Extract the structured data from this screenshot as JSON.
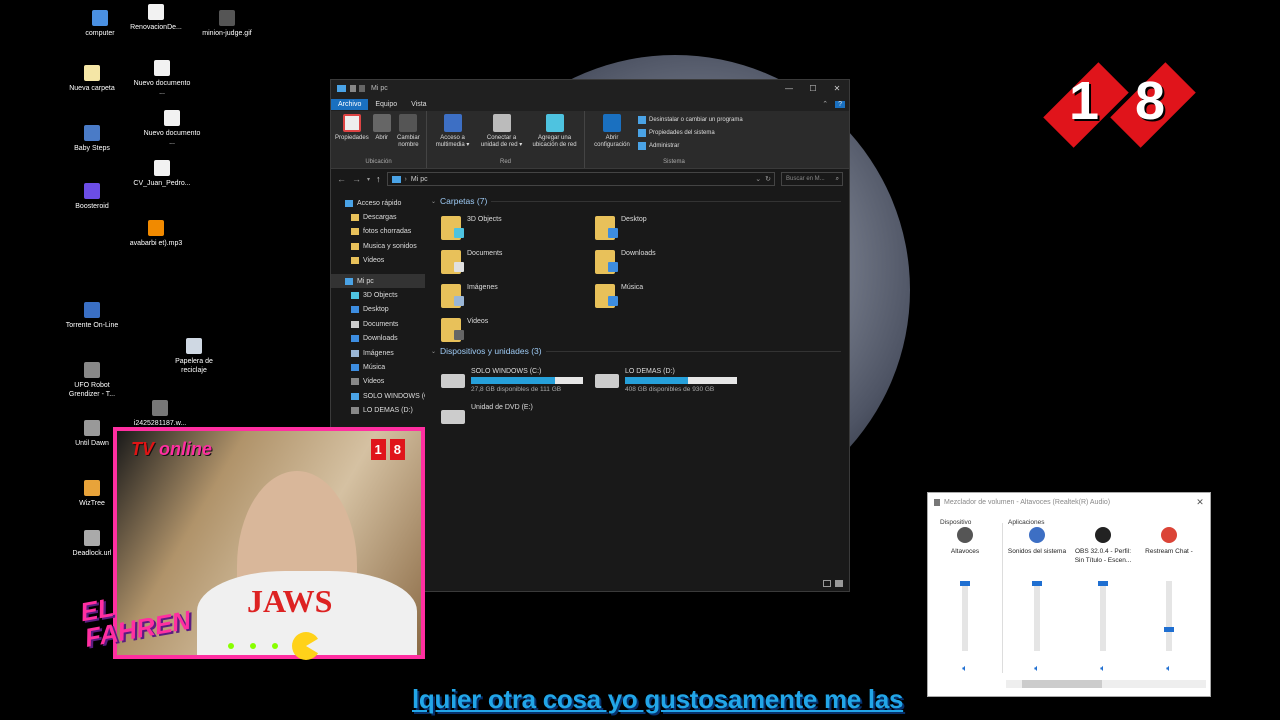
{
  "desktop_icons": [
    {
      "label": "computer",
      "icon": "monitor-icon",
      "color": "#4a90e2"
    },
    {
      "label": "RenovacionDe...",
      "icon": "pdf-icon",
      "color": "#f2f2f2"
    },
    {
      "label": "minion-judge.gif",
      "icon": "gif-icon",
      "color": "#555555"
    },
    {
      "label": "Nueva carpeta",
      "icon": "file-icon",
      "color": "#f5e6a6"
    },
    {
      "label": "Nuevo documento ...",
      "icon": "document-icon",
      "color": "#f2f2f2"
    },
    {
      "label": "Baby Steps",
      "icon": "game-icon",
      "color": "#4a7bc7"
    },
    {
      "label": "Nuevo documento ...",
      "icon": "document-icon",
      "color": "#f2f2f2"
    },
    {
      "label": "Boosteroid",
      "icon": "boosteroid-icon",
      "color": "#6b4de6"
    },
    {
      "label": "CV_Juan_Pedro...",
      "icon": "document-icon",
      "color": "#f2f2f2"
    },
    {
      "label": "avabarbi et).mp3",
      "icon": "vlc-icon",
      "color": "#f18a00"
    },
    {
      "label": "Torrente On-Line",
      "icon": "torrent-icon",
      "color": "#3a6fc4"
    },
    {
      "label": "Papelera de reciclaje",
      "icon": "recycle-bin-icon",
      "color": "#cfd8e3"
    },
    {
      "label": "UFO Robot Grendizer - T...",
      "icon": "game-icon",
      "color": "#888888"
    },
    {
      "label": "Until Dawn",
      "icon": "game-icon",
      "color": "#999999"
    },
    {
      "label": "i2425281187.w...",
      "icon": "image-icon",
      "color": "#777777"
    },
    {
      "label": "WizTree",
      "icon": "wiztree-icon",
      "color": "#e8a33a"
    },
    {
      "label": "Deadlock.url",
      "icon": "link-icon",
      "color": "#aaaaaa"
    }
  ],
  "badge": {
    "digits": [
      "1",
      "8"
    ],
    "color": "#e0141b"
  },
  "explorer": {
    "title": "Mi pc",
    "window_controls": [
      "—",
      "☐",
      "✕"
    ],
    "tabs": [
      "Archivo",
      "Equipo",
      "Vista"
    ],
    "ribbon": {
      "groups": [
        {
          "label": "Ubicación",
          "buttons": [
            "Propiedades",
            "Abrir",
            "Cambiar nombre"
          ]
        },
        {
          "label": "Red",
          "buttons": [
            "Acceso a multimedia ▾",
            "Conectar a unidad de red ▾",
            "Agregar una ubicación de red"
          ]
        },
        {
          "label": "Sistema",
          "buttons": [
            "Abrir configuración"
          ],
          "small": [
            "Desinstalar o cambiar un programa",
            "Propiedades del sistema",
            "Administrar"
          ]
        }
      ]
    },
    "address": {
      "path": "Mi pc",
      "search_placeholder": "Buscar en M..."
    },
    "nav": [
      {
        "label": "Acceso rápido",
        "top": true,
        "icon": "star-icon",
        "color": "#4aa3e6"
      },
      {
        "label": "Descargas",
        "icon": "folder-icon",
        "color": "#e8c15a"
      },
      {
        "label": "fotos chorradas",
        "icon": "folder-icon",
        "color": "#e8c15a"
      },
      {
        "label": "Musica y sonidos",
        "icon": "folder-icon",
        "color": "#e8c15a"
      },
      {
        "label": "Videos",
        "icon": "folder-icon",
        "color": "#e8c15a"
      },
      {
        "label": "Mi pc",
        "top": true,
        "selected": true,
        "icon": "monitor-icon",
        "color": "#4aa3e6"
      },
      {
        "label": "3D Objects",
        "icon": "cube-icon",
        "color": "#4ec3e0"
      },
      {
        "label": "Desktop",
        "icon": "desktop-icon",
        "color": "#3d8de0"
      },
      {
        "label": "Documents",
        "icon": "document-icon",
        "color": "#cccccc"
      },
      {
        "label": "Downloads",
        "icon": "download-icon",
        "color": "#3d8de0"
      },
      {
        "label": "Imágenes",
        "icon": "image-icon",
        "color": "#9ab6d6"
      },
      {
        "label": "Música",
        "icon": "music-icon",
        "color": "#3d8de0"
      },
      {
        "label": "Videos",
        "icon": "video-icon",
        "color": "#888888"
      },
      {
        "label": "SOLO WINDOWS (C:",
        "icon": "drive-icon",
        "color": "#4aa3e6"
      },
      {
        "label": "LO DEMAS (D:)",
        "icon": "drive-icon",
        "color": "#888888"
      }
    ],
    "folders_header": "Carpetas (7)",
    "folders": [
      {
        "label": "3D Objects",
        "badge": "#4ec3e0"
      },
      {
        "label": "Desktop",
        "badge": "#3d8de0"
      },
      {
        "label": "Documents",
        "badge": "#e0e0e0"
      },
      {
        "label": "Downloads",
        "badge": "#3d8de0"
      },
      {
        "label": "Imágenes",
        "badge": "#9ab6d6"
      },
      {
        "label": "Música",
        "badge": "#3d8de0"
      },
      {
        "label": "Videos",
        "badge": "#666666"
      }
    ],
    "drives_header": "Dispositivos y unidades (3)",
    "drives": [
      {
        "label": "SOLO WINDOWS (C:)",
        "free": "27,8 GB disponibles de 111 GB",
        "used_fraction": 0.75
      },
      {
        "label": "LO DEMAS (D:)",
        "free": "408 GB disponibles de 930 GB",
        "used_fraction": 0.56
      },
      {
        "label": "Unidad de DVD (E:)",
        "free": "",
        "used_fraction": null
      }
    ]
  },
  "webcam": {
    "overlay_title_a": "TV",
    "overlay_title_b": "online",
    "shirt_text": "JAWS",
    "badge_digits": [
      "1",
      "8"
    ],
    "brand_line1": "EL",
    "brand_line2": "FAHREN"
  },
  "mixer": {
    "title": "Mezclador de volumen - Altavoces (Realtek(R) Audio)",
    "device_header": "Dispositivo",
    "apps_header": "Aplicaciones",
    "columns": [
      {
        "name": "Altavoces",
        "icon": "speaker-icon",
        "color": "#555555",
        "level": 1.0
      },
      {
        "name": "Sonidos del sistema",
        "icon": "system-sounds-icon",
        "color": "#3d6fc4",
        "level": 1.0
      },
      {
        "name": "OBS 32.0.4 - Perfil: Sin Título - Escen...",
        "icon": "obs-icon",
        "color": "#222222",
        "level": 1.0
      },
      {
        "name": "Restream Chat -",
        "icon": "chrome-icon",
        "color": "#db4437",
        "level": 0.3
      }
    ]
  },
  "subtitle": "lquier otra cosa yo gustosamente me las"
}
